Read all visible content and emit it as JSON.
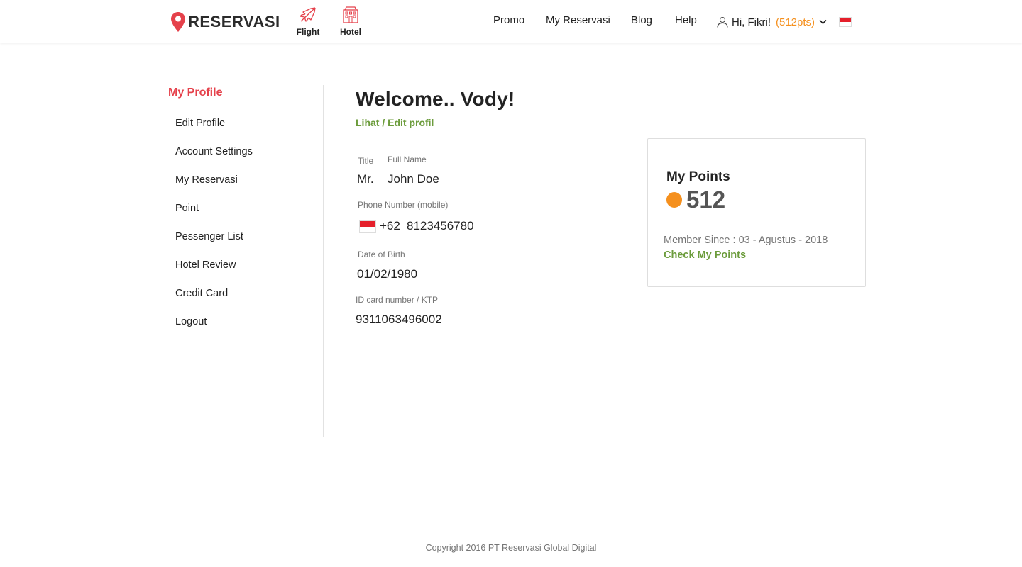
{
  "header": {
    "logo_text": "RESERVASI",
    "services": [
      {
        "label": "Flight",
        "icon": "airplane-icon"
      },
      {
        "label": "Hotel",
        "icon": "hotel-building-icon"
      }
    ],
    "nav": [
      "Promo",
      "My Reservasi",
      "Blog",
      "Help"
    ],
    "user": {
      "greeting": "Hi, Fikri!",
      "points": "(512pts)",
      "icon": "user-icon"
    },
    "language_flag": "indonesia-flag-icon"
  },
  "sidebar": {
    "title": "My Profile",
    "items": [
      "Edit Profile",
      "Account Settings",
      "My Reservasi",
      "Point",
      "Pessenger List",
      "Hotel Review",
      "Credit Card",
      "Logout"
    ]
  },
  "profile": {
    "welcome": "Welcome.. Vody!",
    "edit_link": "Lihat / Edit profil",
    "title_label": "Title",
    "title_value": "Mr.",
    "fullname_label": "Full Name",
    "fullname_value": "John Doe",
    "phone_label": "Phone Number (mobile)",
    "phone_code": "+62",
    "phone_number": "8123456780",
    "dob_label": "Date of Birth",
    "dob_value": "01/02/1980",
    "id_label": "ID card number / KTP",
    "id_value": "9311063496002"
  },
  "points_card": {
    "title": "My Points",
    "value": "512",
    "member_since": "Member Since : 03 - Agustus - 2018",
    "check_link": "Check My Points"
  },
  "footer": {
    "copyright": "Copyright 2016 PT Reservasi Global Digital"
  },
  "colors": {
    "brand_red": "#e5414b",
    "accent_orange": "#f5901e",
    "link_green": "#6c9c3c",
    "text_dark": "#222222",
    "text_muted": "#757575"
  }
}
